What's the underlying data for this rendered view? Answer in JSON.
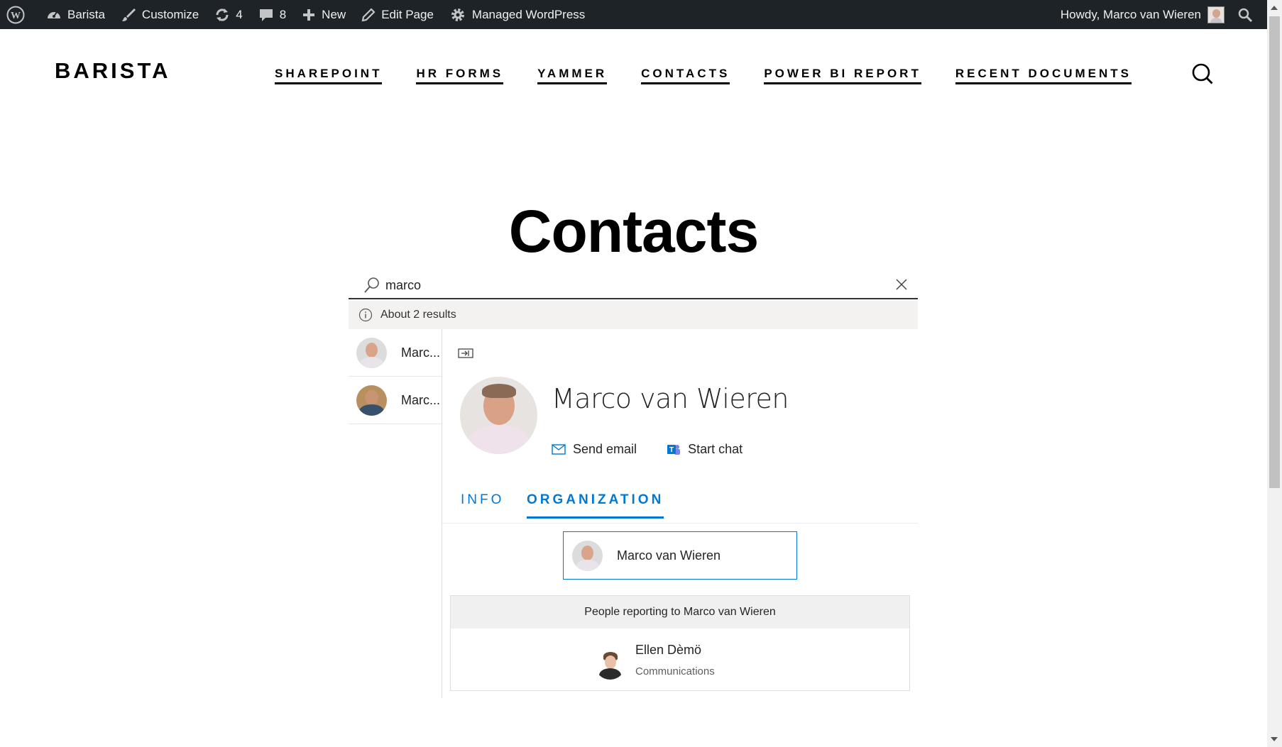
{
  "admin_bar": {
    "site_name": "Barista",
    "customize": "Customize",
    "updates_count": "4",
    "comments_count": "8",
    "new": "New",
    "edit_page": "Edit Page",
    "managed": "Managed WordPress",
    "howdy": "Howdy, Marco van Wieren"
  },
  "site": {
    "title": "BARISTA",
    "nav": [
      "SHAREPOINT",
      "HR FORMS",
      "YAMMER",
      "CONTACTS",
      "POWER BI REPORT",
      "RECENT DOCUMENTS"
    ]
  },
  "page": {
    "title": "Contacts"
  },
  "search": {
    "value": "marco",
    "result_text": "About 2 results"
  },
  "results": [
    {
      "name": "Marc..."
    },
    {
      "name": "Marc..."
    }
  ],
  "detail": {
    "name": "Marco van Wieren",
    "send_email": "Send email",
    "start_chat": "Start chat",
    "tabs": [
      "INFO",
      "ORGANIZATION"
    ],
    "active_tab": "ORGANIZATION",
    "manager_name": "Marco van Wieren",
    "reports_header": "People reporting to Marco van Wieren",
    "reports": [
      {
        "name": "Ellen Dèmö",
        "department": "Communications"
      }
    ]
  },
  "colors": {
    "admin_bar": "#1d2327",
    "accent": "#0078d4",
    "result_bar": "#f3f2f1"
  }
}
